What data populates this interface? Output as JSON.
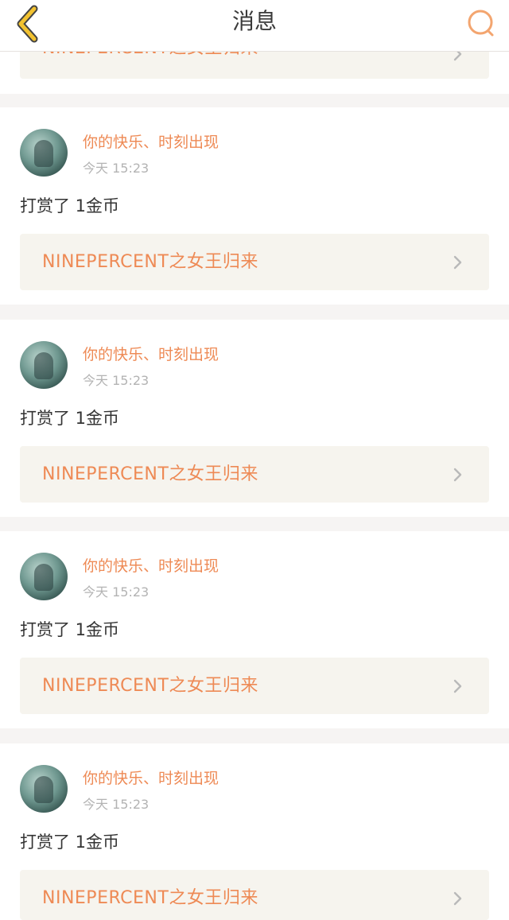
{
  "header": {
    "title": "消息",
    "back_icon": "chevron-left-icon",
    "search_icon": "search-icon"
  },
  "colors": {
    "accent": "#ee8a55",
    "back_icon": "#f2c230",
    "search_icon": "#f3a56f"
  },
  "top_partial": {
    "link_text": "NINEPERCENT之女王归来"
  },
  "messages": [
    {
      "username": "你的快乐、时刻出现",
      "time": "今天 15:23",
      "action": "打赏了 1金币",
      "link_text": "NINEPERCENT之女王归来"
    },
    {
      "username": "你的快乐、时刻出现",
      "time": "今天 15:23",
      "action": "打赏了 1金币",
      "link_text": "NINEPERCENT之女王归来"
    },
    {
      "username": "你的快乐、时刻出现",
      "time": "今天 15:23",
      "action": "打赏了 1金币",
      "link_text": "NINEPERCENT之女王归来"
    },
    {
      "username": "你的快乐、时刻出现",
      "time": "今天 15:23",
      "action": "打赏了 1金币",
      "link_text": "NINEPERCENT之女王归来"
    }
  ]
}
